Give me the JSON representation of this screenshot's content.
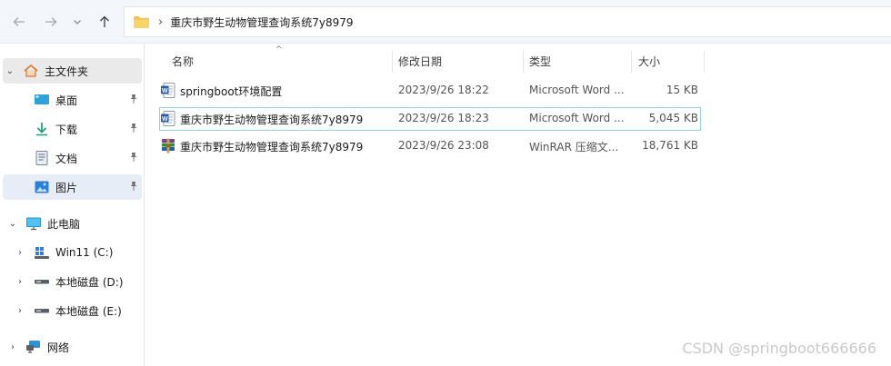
{
  "toolbar": {
    "back_icon": "arrow-left-icon",
    "forward_icon": "arrow-right-icon",
    "recent_icon": "chevron-down-icon",
    "up_icon": "arrow-up-icon"
  },
  "address": {
    "separator": "›",
    "path": "重庆市野生动物管理查询系统7y8979"
  },
  "sidebar": {
    "items": [
      {
        "label": "主文件夹",
        "icon": "home-icon",
        "chevron": "⌄"
      },
      {
        "label": "桌面",
        "icon": "desktop-icon",
        "pinned": true
      },
      {
        "label": "下载",
        "icon": "download-icon",
        "pinned": true
      },
      {
        "label": "文档",
        "icon": "document-icon",
        "pinned": true
      },
      {
        "label": "图片",
        "icon": "picture-icon",
        "pinned": true
      },
      {
        "label": "此电脑",
        "icon": "computer-icon",
        "chevron": "⌄"
      },
      {
        "label": "Win11 (C:)",
        "icon": "windows-drive-icon",
        "chevron": "›"
      },
      {
        "label": "本地磁盘 (D:)",
        "icon": "drive-icon",
        "chevron": "›"
      },
      {
        "label": "本地磁盘 (E:)",
        "icon": "drive-icon",
        "chevron": "›"
      },
      {
        "label": "网络",
        "icon": "network-icon",
        "chevron": "›"
      }
    ]
  },
  "columns": {
    "name": "名称",
    "date": "修改日期",
    "type": "类型",
    "size": "大小",
    "sort_indicator": "^"
  },
  "files": [
    {
      "name": "springboot环境配置",
      "date": "2023/9/26 18:22",
      "type": "Microsoft Word ...",
      "size": "15 KB",
      "icon": "word-doc-icon"
    },
    {
      "name": "重庆市野生动物管理查询系统7y8979",
      "date": "2023/9/26 18:23",
      "type": "Microsoft Word ...",
      "size": "5,045 KB",
      "icon": "word-doc-icon"
    },
    {
      "name": "重庆市野生动物管理查询系统7y8979",
      "date": "2023/9/26 23:08",
      "type": "WinRAR 压缩文...",
      "size": "18,761 KB",
      "icon": "winrar-archive-icon"
    }
  ],
  "watermark": "CSDN @springboot666666"
}
